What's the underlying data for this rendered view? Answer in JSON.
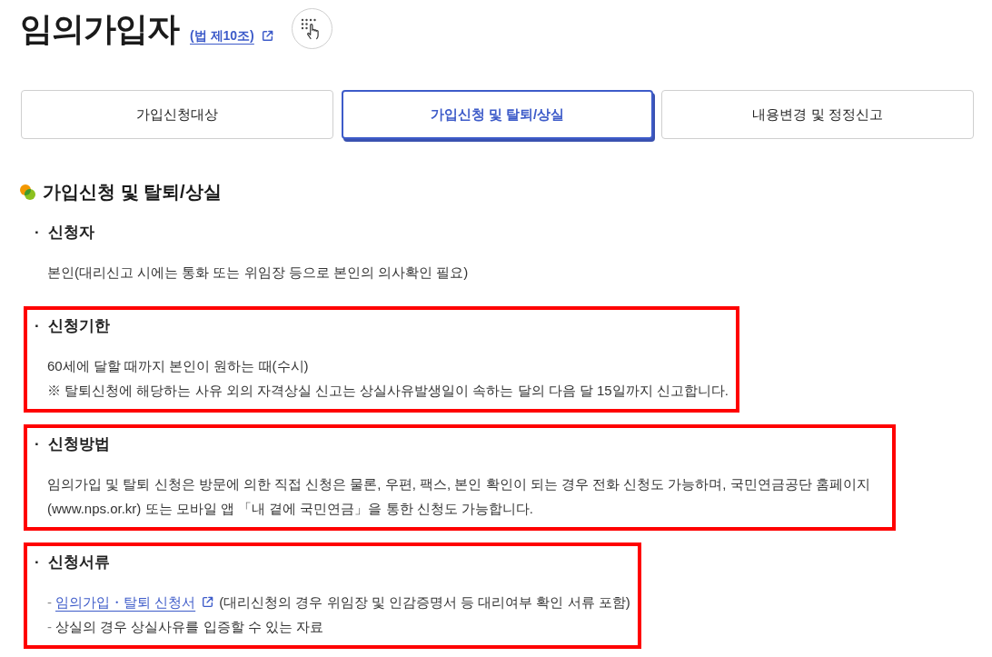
{
  "page": {
    "title": "임의가입자",
    "law_link": "(법 제10조)"
  },
  "tabs": [
    {
      "label": "가입신청대상",
      "selected": false
    },
    {
      "label": "가입신청 및 탈퇴/상실",
      "selected": true
    },
    {
      "label": "내용변경 및 정정신고",
      "selected": false
    }
  ],
  "section": {
    "title": "가입신청 및 탈퇴/상실",
    "items": [
      {
        "kind": "text",
        "marker": "·",
        "heading": "신청자",
        "highlighted": false,
        "lines": [
          "본인(대리신고 시에는 통화 또는 위임장 등으로 본인의 의사확인 필요)"
        ]
      },
      {
        "kind": "text",
        "marker": "·",
        "heading": "신청기한",
        "highlighted": true,
        "lines": [
          "60세에 달할 때까지 본인이 원하는 때(수시)",
          "※ 탈퇴신청에 해당하는 사유 외의 자격상실 신고는 상실사유발생일이 속하는 달의 다음 달 15일까지 신고합니다."
        ]
      },
      {
        "kind": "text",
        "marker": "·",
        "heading": "신청방법",
        "highlighted": true,
        "lines": [
          "임의가입 및 탈퇴 신청은 방문에 의한 직접 신청은 물론, 우편, 팩스, 본인 확인이 되는 경우 전화 신청도 가능하며, 국민연금공단 홈페이지 (www.nps.or.kr) 또는 모바일 앱 「내 곁에 국민연금」을 통한 신청도 가능합니다."
        ]
      },
      {
        "kind": "list",
        "marker": "·",
        "heading": "신청서류",
        "highlighted": true,
        "entries": [
          {
            "marker": "-",
            "link": "임의가입・탈퇴 신청서",
            "text": "(대리신청의 경우 위임장 및 인감증명서 등 대리여부 확인 서류 포함)"
          },
          {
            "marker": "-",
            "text": "상실의 경우 상실사유를 입증할 수 있는 자료"
          }
        ]
      }
    ]
  }
}
